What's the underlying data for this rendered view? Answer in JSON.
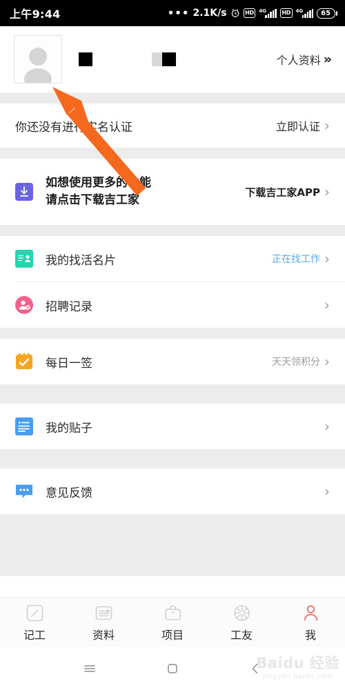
{
  "statusbar": {
    "time": "上午9:44",
    "dots": "•••",
    "network_speed": "2.1K/s",
    "alarm_icon": "alarm-clock-icon",
    "hd_label_1": "HD",
    "signal_label_1": "4G",
    "hd_label_2": "HD",
    "signal_label_2": "4G",
    "battery_level": "65"
  },
  "profile": {
    "avatar_icon": "default-avatar-icon",
    "redacted_name": "",
    "redacted_info": "",
    "link_label": "个人资料",
    "link_chevron": "»"
  },
  "verify": {
    "label": "你还没有进行实名认证",
    "action": "立即认证",
    "chevron": "›"
  },
  "download_banner": {
    "icon": "download-icon",
    "icon_color": "#6C63E0",
    "line1": "如想使用更多的功能",
    "line2": "请点击下载吉工家",
    "action": "下载吉工家APP",
    "chevron": "›"
  },
  "menu_groups": [
    {
      "items": [
        {
          "label": "我的找活名片",
          "icon": "id-card-icon",
          "icon_color": "#27D4AC",
          "value": "正在找工作",
          "value_style": "blue",
          "chevron": "›"
        },
        {
          "label": "招聘记录",
          "icon": "recruit-person-icon",
          "icon_color": "#F2628C",
          "value": "",
          "value_style": "grey",
          "chevron": "›"
        }
      ]
    },
    {
      "items": [
        {
          "label": "每日一签",
          "icon": "calendar-check-icon",
          "icon_color": "#F5A623",
          "value": "天天领积分",
          "value_style": "grey",
          "chevron": "›"
        }
      ]
    },
    {
      "items": [
        {
          "label": "我的贴子",
          "icon": "document-list-icon",
          "icon_color": "#4A9DEC",
          "value": "",
          "value_style": "grey",
          "chevron": "›"
        }
      ]
    },
    {
      "items": [
        {
          "label": "意见反馈",
          "icon": "speech-bubble-icon",
          "icon_color": "#4A9DEC",
          "value": "",
          "value_style": "grey",
          "chevron": "›"
        }
      ]
    }
  ],
  "tabbar": {
    "active_color": "#E8766E",
    "inactive_color": "#CFCFCF",
    "tabs": [
      {
        "label": "记工",
        "icon": "pencil-square-icon",
        "active": false
      },
      {
        "label": "资料",
        "icon": "document-icon",
        "active": false
      },
      {
        "label": "项目",
        "icon": "briefcase-icon",
        "active": false
      },
      {
        "label": "工友",
        "icon": "aperture-icon",
        "active": false
      },
      {
        "label": "我",
        "icon": "person-icon",
        "active": true
      }
    ]
  },
  "navbar": {
    "menu_icon": "hamburger-menu-icon",
    "home_icon": "home-square-icon",
    "back_icon": "back-chevron-icon"
  },
  "watermark": {
    "main": "Baidu 经验",
    "sub": "jingyan.baidu.com"
  },
  "annotation": {
    "arrow_color": "#F4691E",
    "arrow_name": "pointer-arrow-to-avatar"
  }
}
